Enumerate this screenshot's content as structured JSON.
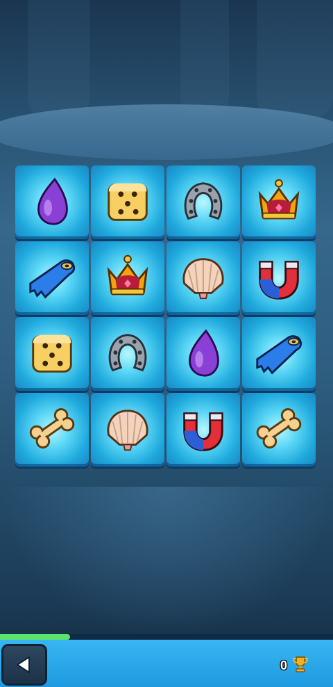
{
  "board": {
    "columns": 4,
    "rows": 4,
    "tiles": [
      "purple-drop",
      "dice",
      "horseshoe",
      "crown",
      "swim-fin",
      "crown",
      "seashell",
      "magnet",
      "dice",
      "horseshoe",
      "purple-drop",
      "swim-fin",
      "bone",
      "seashell",
      "magnet",
      "bone"
    ]
  },
  "progress": {
    "fraction": 0.21
  },
  "footer": {
    "score": "0",
    "back_icon": "triangle-left-icon",
    "trophy_icon": "trophy-icon"
  },
  "colors": {
    "tile": "#3cc4ee",
    "bar": "#2aa8ea",
    "progress": "#5be36a"
  }
}
